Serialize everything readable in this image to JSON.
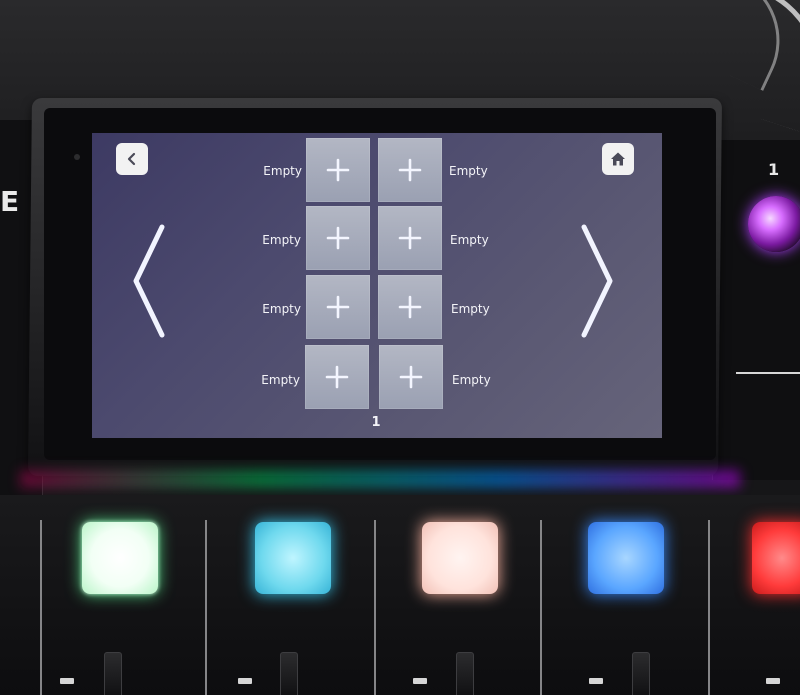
{
  "device": {
    "brand_letter": "E",
    "knob_channel": "1",
    "pad_colors": [
      "#b9f5c8",
      "#6fd9ee",
      "#ffe3dc",
      "#5aa6ff",
      "#ff3b3b"
    ]
  },
  "screen": {
    "back_icon": "chevron-left-icon",
    "home_icon": "home-icon",
    "prev_icon": "chevron-left-icon",
    "next_icon": "chevron-right-icon",
    "page_number": "1",
    "slots": [
      {
        "label": "Empty",
        "icon": "plus-icon"
      },
      {
        "label": "Empty",
        "icon": "plus-icon"
      },
      {
        "label": "Empty",
        "icon": "plus-icon"
      },
      {
        "label": "Empty",
        "icon": "plus-icon"
      },
      {
        "label": "Empty",
        "icon": "plus-icon"
      },
      {
        "label": "Empty",
        "icon": "plus-icon"
      },
      {
        "label": "Empty",
        "icon": "plus-icon"
      },
      {
        "label": "Empty",
        "icon": "plus-icon"
      }
    ]
  }
}
